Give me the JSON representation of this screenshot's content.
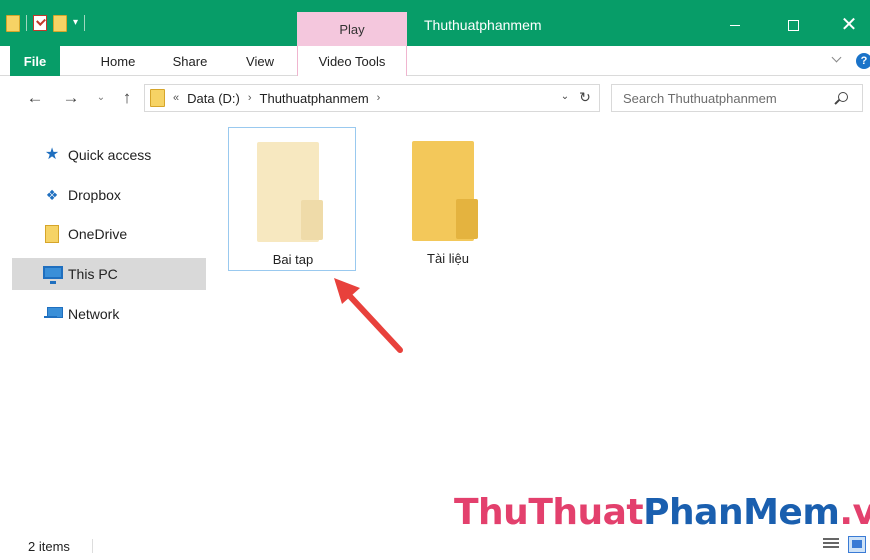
{
  "window": {
    "title": "Thuthuatphanmem",
    "context_tab": "Play"
  },
  "ribbon": {
    "tabs": [
      {
        "label": "File"
      },
      {
        "label": "Home"
      },
      {
        "label": "Share"
      },
      {
        "label": "View"
      },
      {
        "label": "Video Tools"
      }
    ],
    "help": "?"
  },
  "address": {
    "overflow": "«",
    "crumbs": [
      "Data (D:)",
      "Thuthuatphanmem"
    ],
    "separator": "›"
  },
  "search": {
    "placeholder": "Search Thuthuatphanmem"
  },
  "nav_pane": {
    "items": [
      {
        "label": "Quick access",
        "icon": "star-icon"
      },
      {
        "label": "Dropbox",
        "icon": "dropbox-icon"
      },
      {
        "label": "OneDrive",
        "icon": "onedrive-folder-icon"
      },
      {
        "label": "This PC",
        "icon": "computer-icon",
        "selected": true
      },
      {
        "label": "Network",
        "icon": "network-icon"
      }
    ]
  },
  "content": {
    "folders": [
      {
        "name": "Bai tap",
        "selected": true
      },
      {
        "name": "Tài liệu",
        "selected": false
      }
    ]
  },
  "status": {
    "item_count": "2 items"
  },
  "watermark": {
    "part1": "ThuThuat",
    "part2": "PhanMem",
    "part3": ".vn"
  },
  "colors": {
    "titlebar": "#079d68",
    "context_tab": "#f4c7dd",
    "selection": "#d9d9d9",
    "arrow": "#e8413c"
  }
}
